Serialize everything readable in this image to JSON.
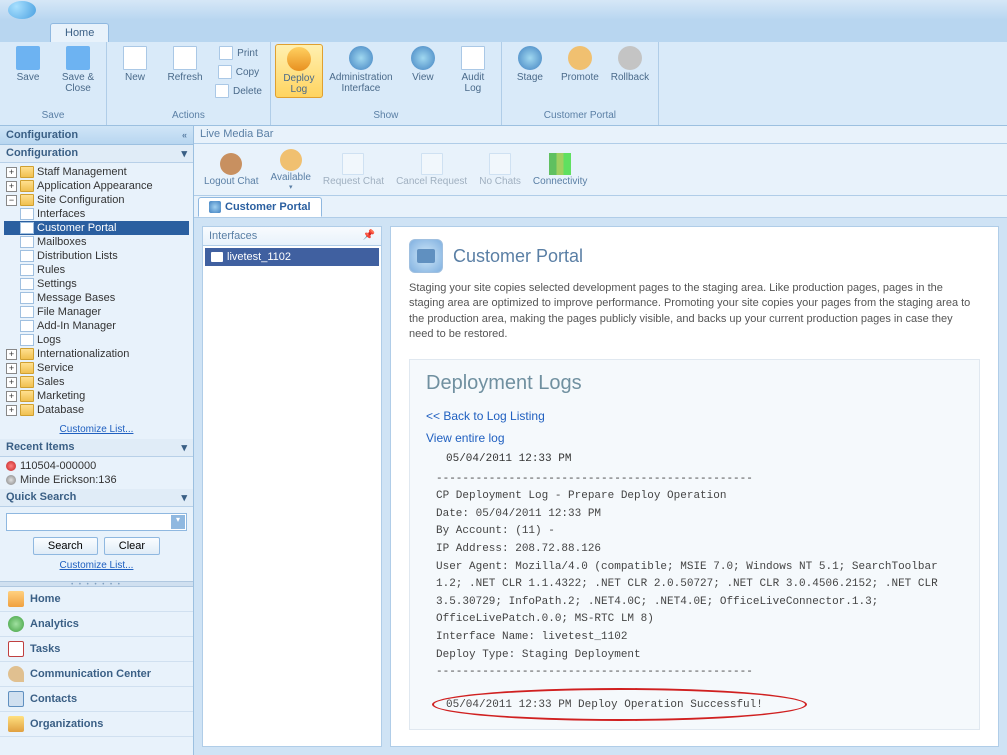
{
  "title_bar": "",
  "tabs": {
    "home": "Home"
  },
  "ribbon": {
    "save": {
      "label": "Save",
      "group": "Save",
      "save_close": "Save &\nClose"
    },
    "actions": {
      "group": "Actions",
      "new": "New",
      "refresh": "Refresh",
      "print": "Print",
      "copy": "Copy",
      "delete": "Delete"
    },
    "show": {
      "group": "Show",
      "deploy_log": "Deploy\nLog",
      "admin": "Administration\nInterface",
      "view": "View",
      "audit": "Audit\nLog"
    },
    "portal": {
      "group": "Customer Portal",
      "stage": "Stage",
      "promote": "Promote",
      "rollback": "Rollback"
    }
  },
  "sidebar": {
    "config_title": "Configuration",
    "config_sub": "Configuration",
    "tree": {
      "staff": "Staff Management",
      "app_appearance": "Application Appearance",
      "site_config": "Site Configuration",
      "interfaces": "Interfaces",
      "customer_portal": "Customer Portal",
      "mailboxes": "Mailboxes",
      "dist_lists": "Distribution Lists",
      "rules": "Rules",
      "settings": "Settings",
      "msg_bases": "Message Bases",
      "file_mgr": "File Manager",
      "addin": "Add-In Manager",
      "logs": "Logs",
      "intl": "Internationalization",
      "service": "Service",
      "sales": "Sales",
      "marketing": "Marketing",
      "database": "Database"
    },
    "customize": "Customize List...",
    "recent_title": "Recent Items",
    "recent": {
      "i1": "110504-000000",
      "i2": "Minde Erickson:136"
    },
    "qsearch_title": "Quick Search",
    "qsearch": {
      "search": "Search",
      "clear": "Clear"
    },
    "nav": {
      "home": "Home",
      "analytics": "Analytics",
      "tasks": "Tasks",
      "comm": "Communication Center",
      "contacts": "Contacts",
      "org": "Organizations"
    }
  },
  "content": {
    "livemedia": "Live Media Bar",
    "chatbar": {
      "logout": "Logout Chat",
      "available": "Available",
      "request": "Request Chat",
      "cancel": "Cancel Request",
      "nochats": "No Chats",
      "connectivity": "Connectivity"
    },
    "doctab": "Customer Portal",
    "interfaces": {
      "title": "Interfaces",
      "item": "livetest_1102"
    },
    "portal": {
      "title": "Customer Portal",
      "desc": "Staging your site copies selected development pages to the staging area. Like production pages, pages in the staging area are optimized to improve performance. Promoting your site copies your pages from the staging area to the production area, making the pages publicly visible, and backs up your current production pages in case they need to be restored.",
      "logs_title": "Deployment Logs",
      "back_link": "<< Back to Log Listing",
      "view_link": "View entire log",
      "log_time": "05/04/2011 12:33 PM",
      "log_body": "------------------------------------------------\nCP Deployment Log - Prepare Deploy Operation\nDate: 05/04/2011 12:33 PM\nBy Account: (11) -\nIP Address: 208.72.88.126\nUser Agent: Mozilla/4.0 (compatible; MSIE 7.0; Windows NT 5.1; SearchToolbar 1.2; .NET CLR 1.1.4322; .NET CLR 2.0.50727; .NET CLR 3.0.4506.2152; .NET CLR 3.5.30729; InfoPath.2; .NET4.0C; .NET4.0E; OfficeLiveConnector.1.3; OfficeLivePatch.0.0; MS-RTC LM 8)\nInterface Name: livetest_1102\nDeploy Type: Staging Deployment\n------------------------------------------------",
      "success": "05/04/2011 12:33 PM Deploy Operation Successful!"
    }
  }
}
